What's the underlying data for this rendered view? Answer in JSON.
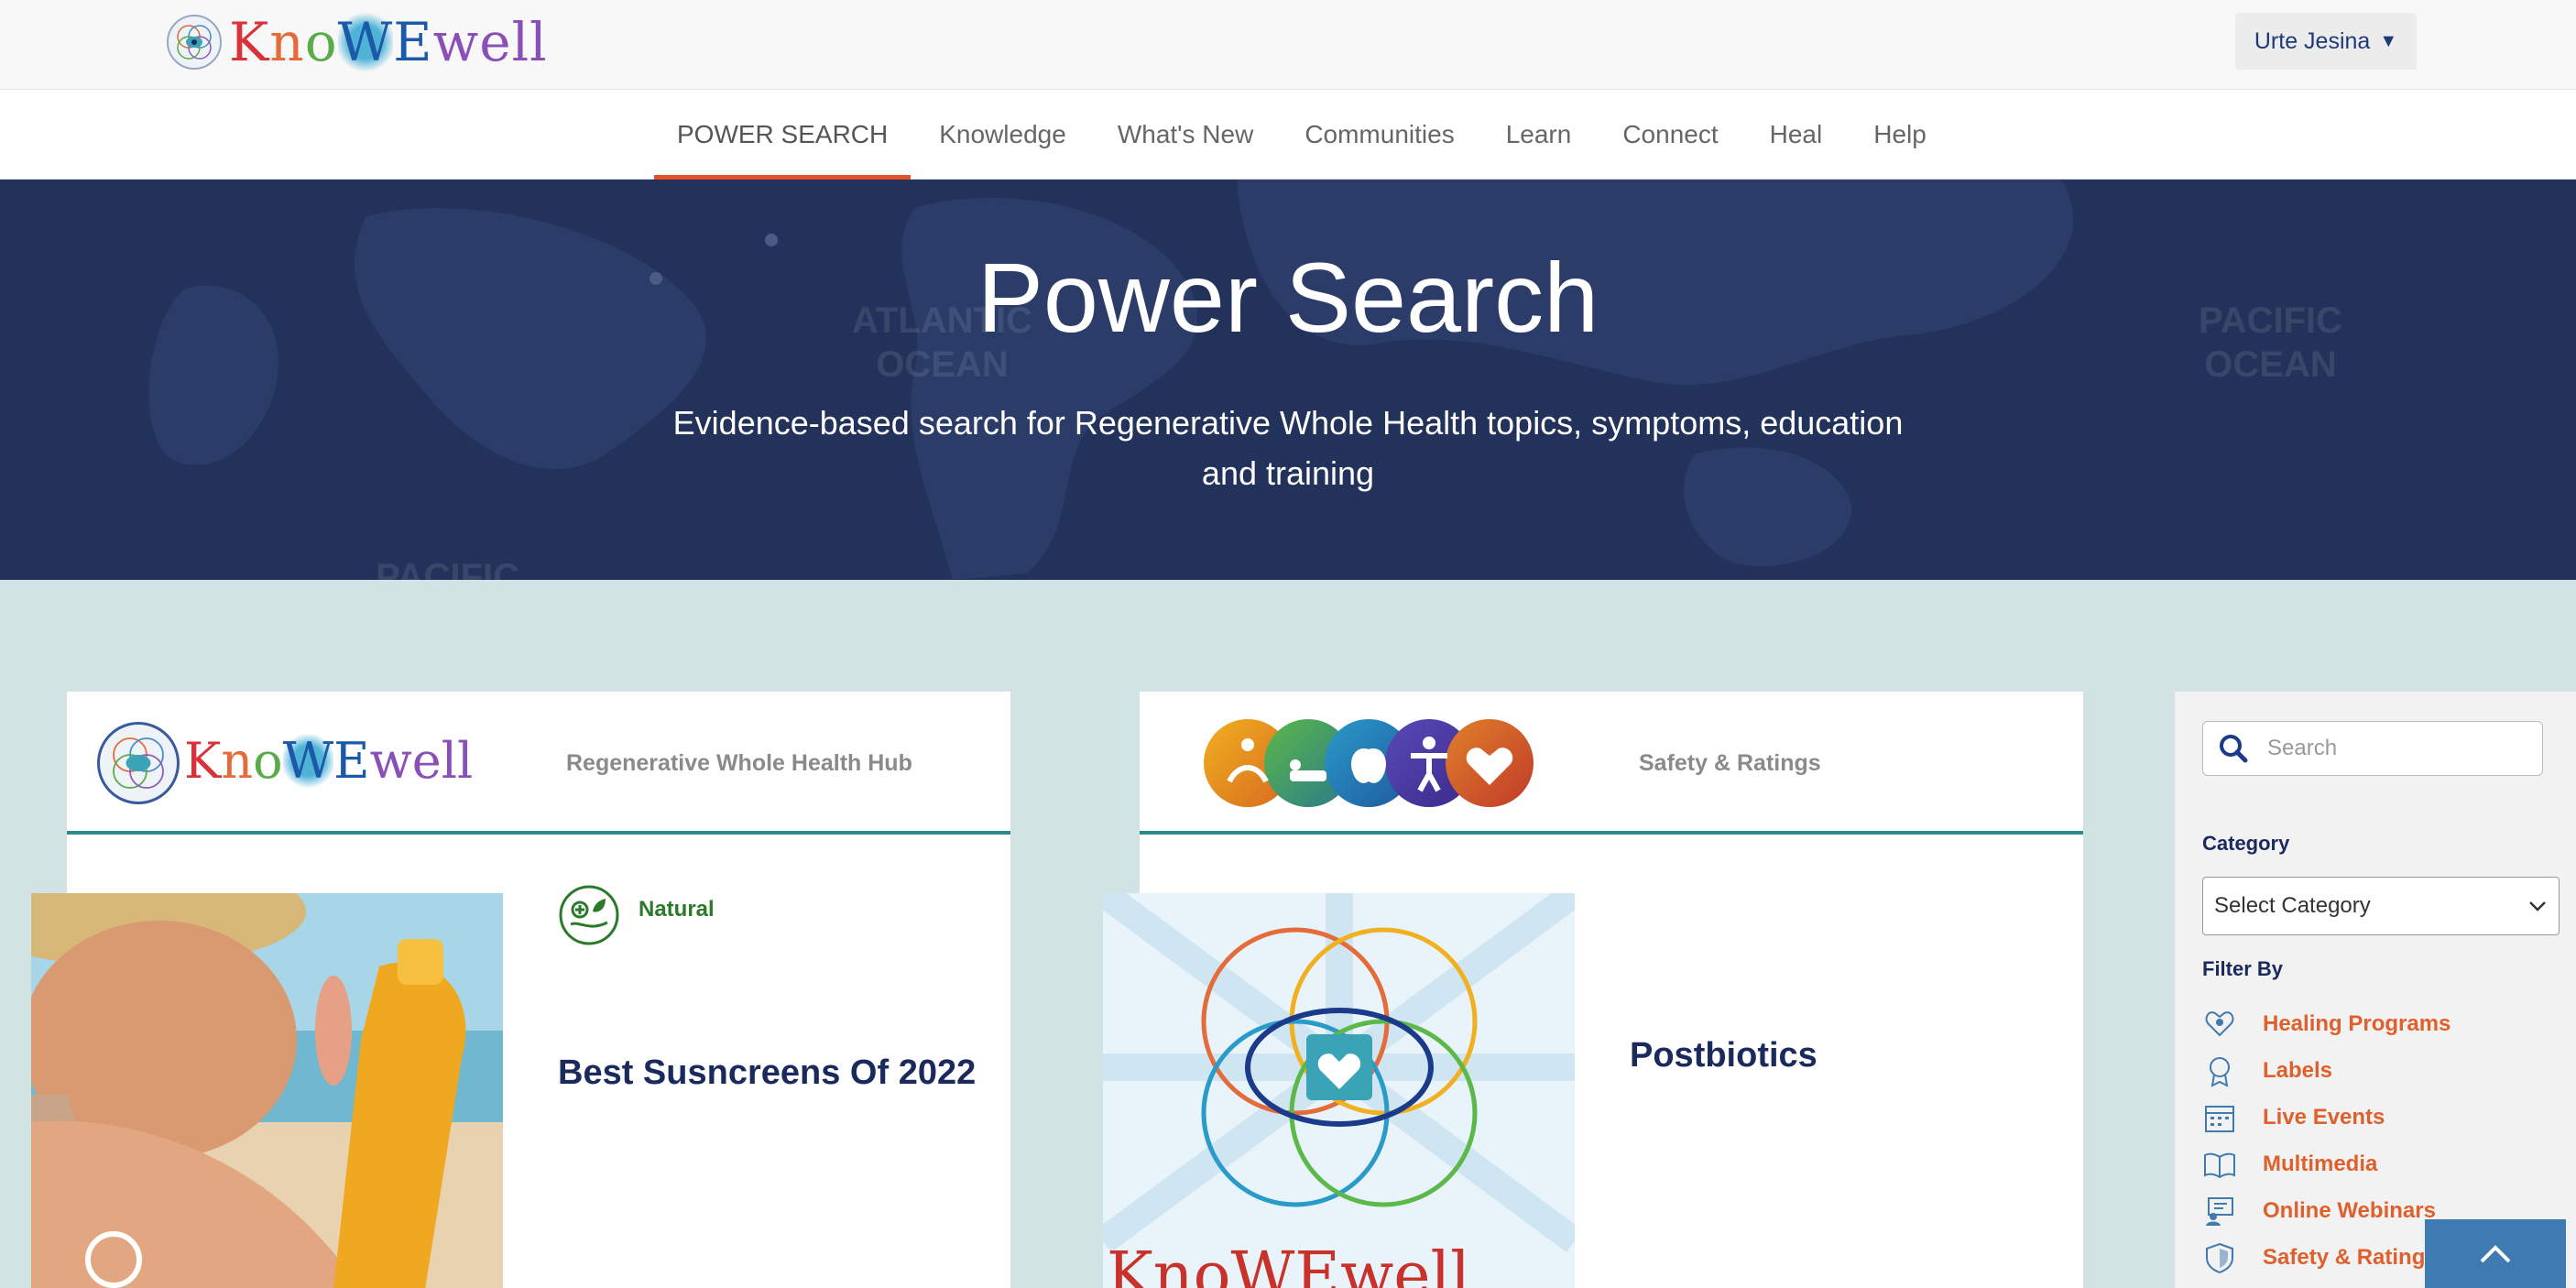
{
  "header": {
    "logo_text_parts": [
      "K",
      "n",
      "o",
      "W",
      "E",
      "well"
    ],
    "logo_alt": "KnoWEwell",
    "user_name": "Urte Jesina",
    "user_caret": "▼"
  },
  "nav": {
    "items": [
      {
        "label": "POWER SEARCH",
        "active": true
      },
      {
        "label": "Knowledge",
        "active": false
      },
      {
        "label": "What's New",
        "active": false
      },
      {
        "label": "Communities",
        "active": false
      },
      {
        "label": "Learn",
        "active": false
      },
      {
        "label": "Connect",
        "active": false
      },
      {
        "label": "Heal",
        "active": false
      },
      {
        "label": "Help",
        "active": false
      }
    ]
  },
  "hero": {
    "title": "Power Search",
    "subtitle": "Evidence-based search for Regenerative Whole Health topics, symptoms, education and training",
    "map_labels": [
      "ATLANTIC\nOCEAN",
      "PACIFIC\nOCEAN",
      "PACIFIC"
    ]
  },
  "cards": [
    {
      "header_label": "Regenerative Whole Health Hub",
      "tag": "Natural",
      "title": "Best Susncreens Of 2022"
    },
    {
      "header_label": "Safety & Ratings",
      "tag": "",
      "title": "Postbiotics"
    }
  ],
  "sidebar": {
    "search_placeholder": "Search",
    "category_label": "Category",
    "category_selected": "Select Category",
    "filter_label": "Filter By",
    "filters": [
      {
        "label": "Healing Programs",
        "icon": "heart-hands-icon"
      },
      {
        "label": "Labels",
        "icon": "award-icon"
      },
      {
        "label": "Live Events",
        "icon": "calendar-icon"
      },
      {
        "label": "Multimedia",
        "icon": "book-icon"
      },
      {
        "label": "Online Webinars",
        "icon": "webinar-icon"
      },
      {
        "label": "Safety & Ratings",
        "icon": "shield-icon"
      }
    ]
  },
  "colors": {
    "nav_active": "#e2512a",
    "hero_bg": "#23325a",
    "page_bg": "#d2e3e3",
    "title_navy": "#1b2a5c",
    "filter_orange": "#e0602d",
    "card_rule": "#2d8a8a",
    "scroll_top_bg": "#3f7ab0"
  }
}
